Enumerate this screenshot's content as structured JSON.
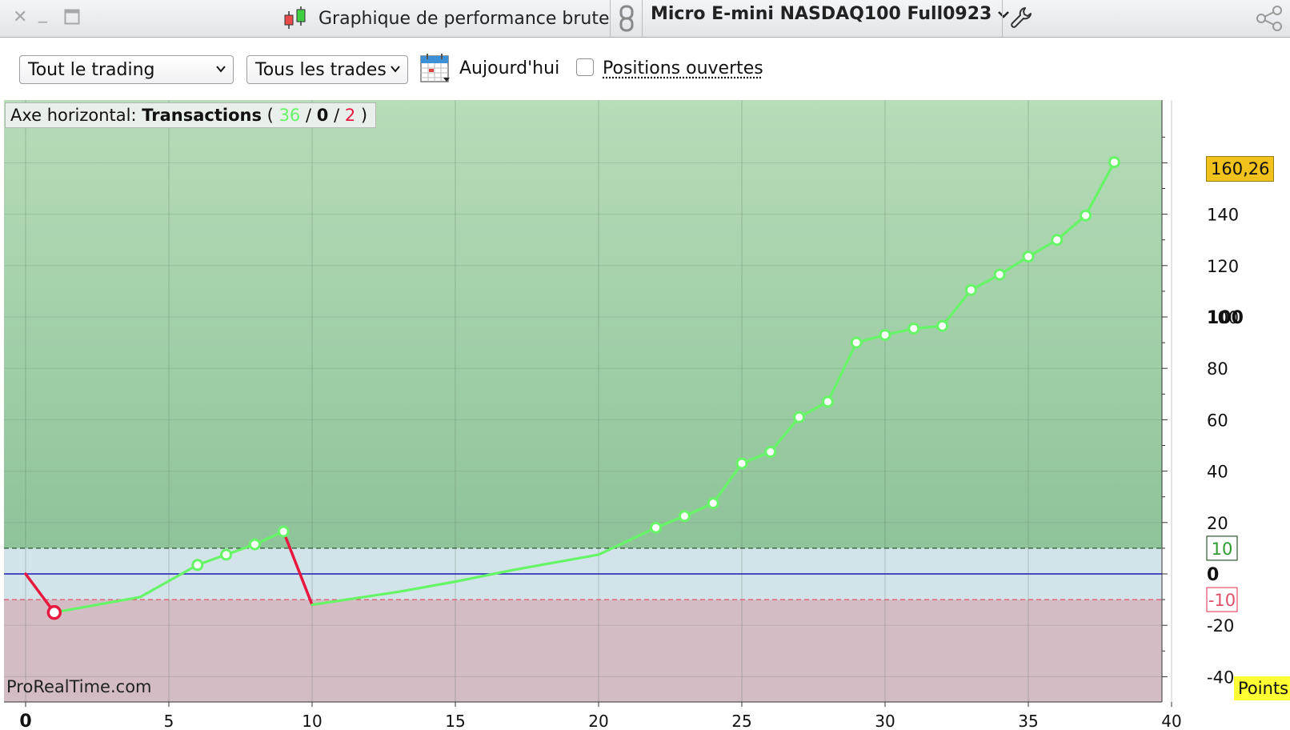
{
  "window": {
    "title": "Graphique de performance brute",
    "instrument": "Micro E-mini NASDAQ100 Full0923"
  },
  "toolbar": {
    "period_select": "Tout le trading",
    "trades_select": "Tous les trades",
    "today_label": "Aujourd'hui",
    "open_positions_label": "Positions ouvertes"
  },
  "axis_badge": {
    "prefix": "Axe horizontal:",
    "name": "Transactions",
    "paren_open": "(",
    "winners": "36",
    "sep1": "/",
    "neutral": "0",
    "sep2": "/",
    "losers": "2",
    "paren_close": ")"
  },
  "last_value_label": "160,26",
  "units_label": "Points",
  "watermark": "ProRealTime.com",
  "colors": {
    "zone_profit": "#a9d4ad",
    "zone_neutral": "#d3e3ea",
    "zone_loss": "#d3bcc4",
    "gain_line": "#66f566",
    "loss_line": "#e8193f",
    "zero_line": "#1a1ab4",
    "last_badge": "#f2c21c",
    "units_badge": "#ffff33"
  },
  "chart_data": {
    "type": "line",
    "xlabel": "",
    "ylabel": "",
    "xlim": [
      0,
      41
    ],
    "ylim": [
      -42,
      178
    ],
    "x_ticks": [
      "0",
      "5",
      "10",
      "15",
      "20",
      "25",
      "30",
      "35",
      "40"
    ],
    "y_ticks": [
      "-40",
      "-20",
      "20",
      "40",
      "60",
      "80",
      "100",
      "120",
      "140"
    ],
    "y_bold_ticks": [
      "0",
      "100"
    ],
    "threshold_labels": [
      "10",
      "-10"
    ],
    "thresholds": {
      "upper": 10,
      "zero": 0,
      "lower": -10
    },
    "points": [
      {
        "x": 0,
        "y": 0
      },
      {
        "x": 1,
        "y": -15,
        "result": "loss"
      },
      {
        "x": 4,
        "y": -9,
        "result": "win"
      },
      {
        "x": 6,
        "y": 3.5,
        "result": "win"
      },
      {
        "x": 7,
        "y": 7.5,
        "result": "win"
      },
      {
        "x": 8,
        "y": 11.5,
        "result": "win"
      },
      {
        "x": 9,
        "y": 16.5,
        "result": "win"
      },
      {
        "x": 10,
        "y": -12,
        "result": "loss"
      },
      {
        "x": 13,
        "y": -7,
        "result": "win"
      },
      {
        "x": 15,
        "y": -3,
        "result": "win"
      },
      {
        "x": 17,
        "y": 1.5,
        "result": "win"
      },
      {
        "x": 20,
        "y": 7.5,
        "result": "win"
      },
      {
        "x": 22,
        "y": 18,
        "result": "win"
      },
      {
        "x": 23,
        "y": 22.5,
        "result": "win"
      },
      {
        "x": 24,
        "y": 27.5,
        "result": "win"
      },
      {
        "x": 25,
        "y": 43,
        "result": "win"
      },
      {
        "x": 26,
        "y": 47.5,
        "result": "win"
      },
      {
        "x": 27,
        "y": 61,
        "result": "win"
      },
      {
        "x": 28,
        "y": 67,
        "result": "win"
      },
      {
        "x": 29,
        "y": 90,
        "result": "win"
      },
      {
        "x": 30,
        "y": 93,
        "result": "win"
      },
      {
        "x": 31,
        "y": 95.5,
        "result": "win"
      },
      {
        "x": 32,
        "y": 96.5,
        "result": "win"
      },
      {
        "x": 33,
        "y": 110.5,
        "result": "win"
      },
      {
        "x": 34,
        "y": 116.5,
        "result": "win"
      },
      {
        "x": 35,
        "y": 123.5,
        "result": "win"
      },
      {
        "x": 36,
        "y": 130,
        "result": "win"
      },
      {
        "x": 37,
        "y": 139.5,
        "result": "win"
      },
      {
        "x": 38,
        "y": 160.26,
        "result": "win"
      }
    ],
    "markers": [
      1,
      6,
      7,
      8,
      9,
      22,
      23,
      24,
      25,
      26,
      27,
      28,
      29,
      30,
      31,
      32,
      33,
      34,
      35,
      36,
      37,
      38
    ]
  }
}
